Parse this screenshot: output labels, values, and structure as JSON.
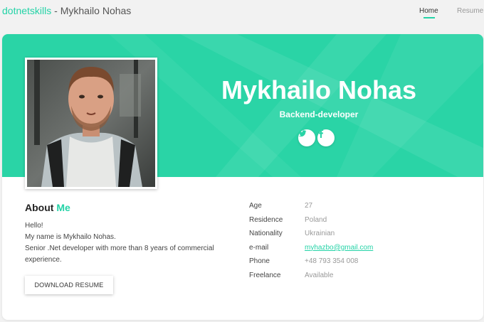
{
  "header": {
    "brand_accent": "dotnetskills",
    "brand_rest": " - Mykhailo Nohas",
    "nav": [
      {
        "label": "Home",
        "active": true
      },
      {
        "label": "Resume",
        "active": false
      }
    ]
  },
  "profile": {
    "name": "Mykhailo Nohas",
    "role": "Backend-developer",
    "social": [
      {
        "icon": "twitter-icon",
        "glyph": "🐦"
      },
      {
        "icon": "facebook-icon",
        "glyph": "f"
      }
    ]
  },
  "about": {
    "title_prefix": "About",
    "title_accent": "Me",
    "lines": [
      "Hello!",
      "My name is Mykhailo Nohas.",
      "Senior .Net developer with more than 8 years of commercial",
      "experience."
    ],
    "download_label": "DOWNLOAD RESUME"
  },
  "details": [
    {
      "label": "Age",
      "value": "27"
    },
    {
      "label": "Residence",
      "value": "Poland"
    },
    {
      "label": "Nationality",
      "value": "Ukrainian"
    },
    {
      "label": "e-mail",
      "value": "myhazbo@gmail.com"
    },
    {
      "label": "Phone",
      "value": "+48 793 354 008"
    },
    {
      "label": "Freelance",
      "value": "Available"
    }
  ],
  "colors": {
    "accent": "#24d3a7",
    "hero": "#2ad4a6",
    "background": "#f2f2f2"
  }
}
